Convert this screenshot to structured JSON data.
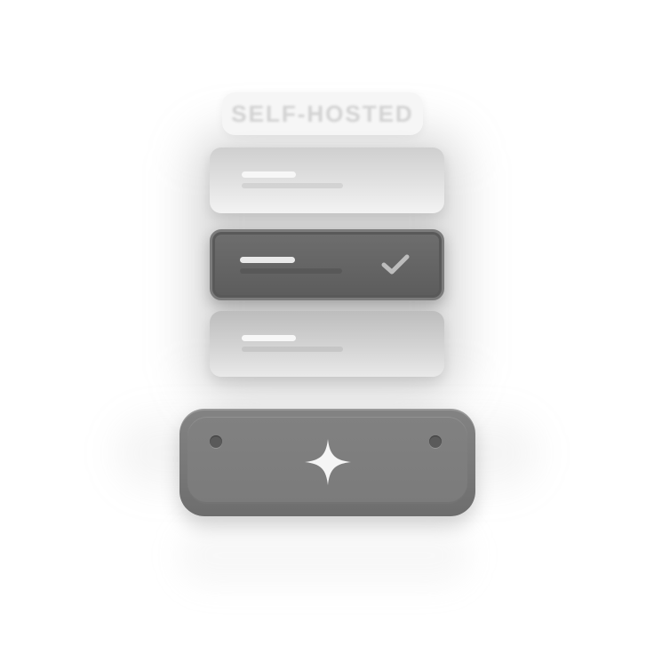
{
  "badge": {
    "label": "SELF-HOSTED"
  },
  "options": [
    {
      "id": "option-1",
      "selected": false
    },
    {
      "id": "option-2",
      "selected": true,
      "indicator_icon": "check-icon"
    },
    {
      "id": "option-3",
      "selected": false
    }
  ],
  "action": {
    "icon": "sparkle-icon"
  },
  "colors": {
    "background": "#ffffff",
    "selected_option": "#666666",
    "action_button": "#7b7b7b",
    "icon": "#f5f5f5"
  }
}
